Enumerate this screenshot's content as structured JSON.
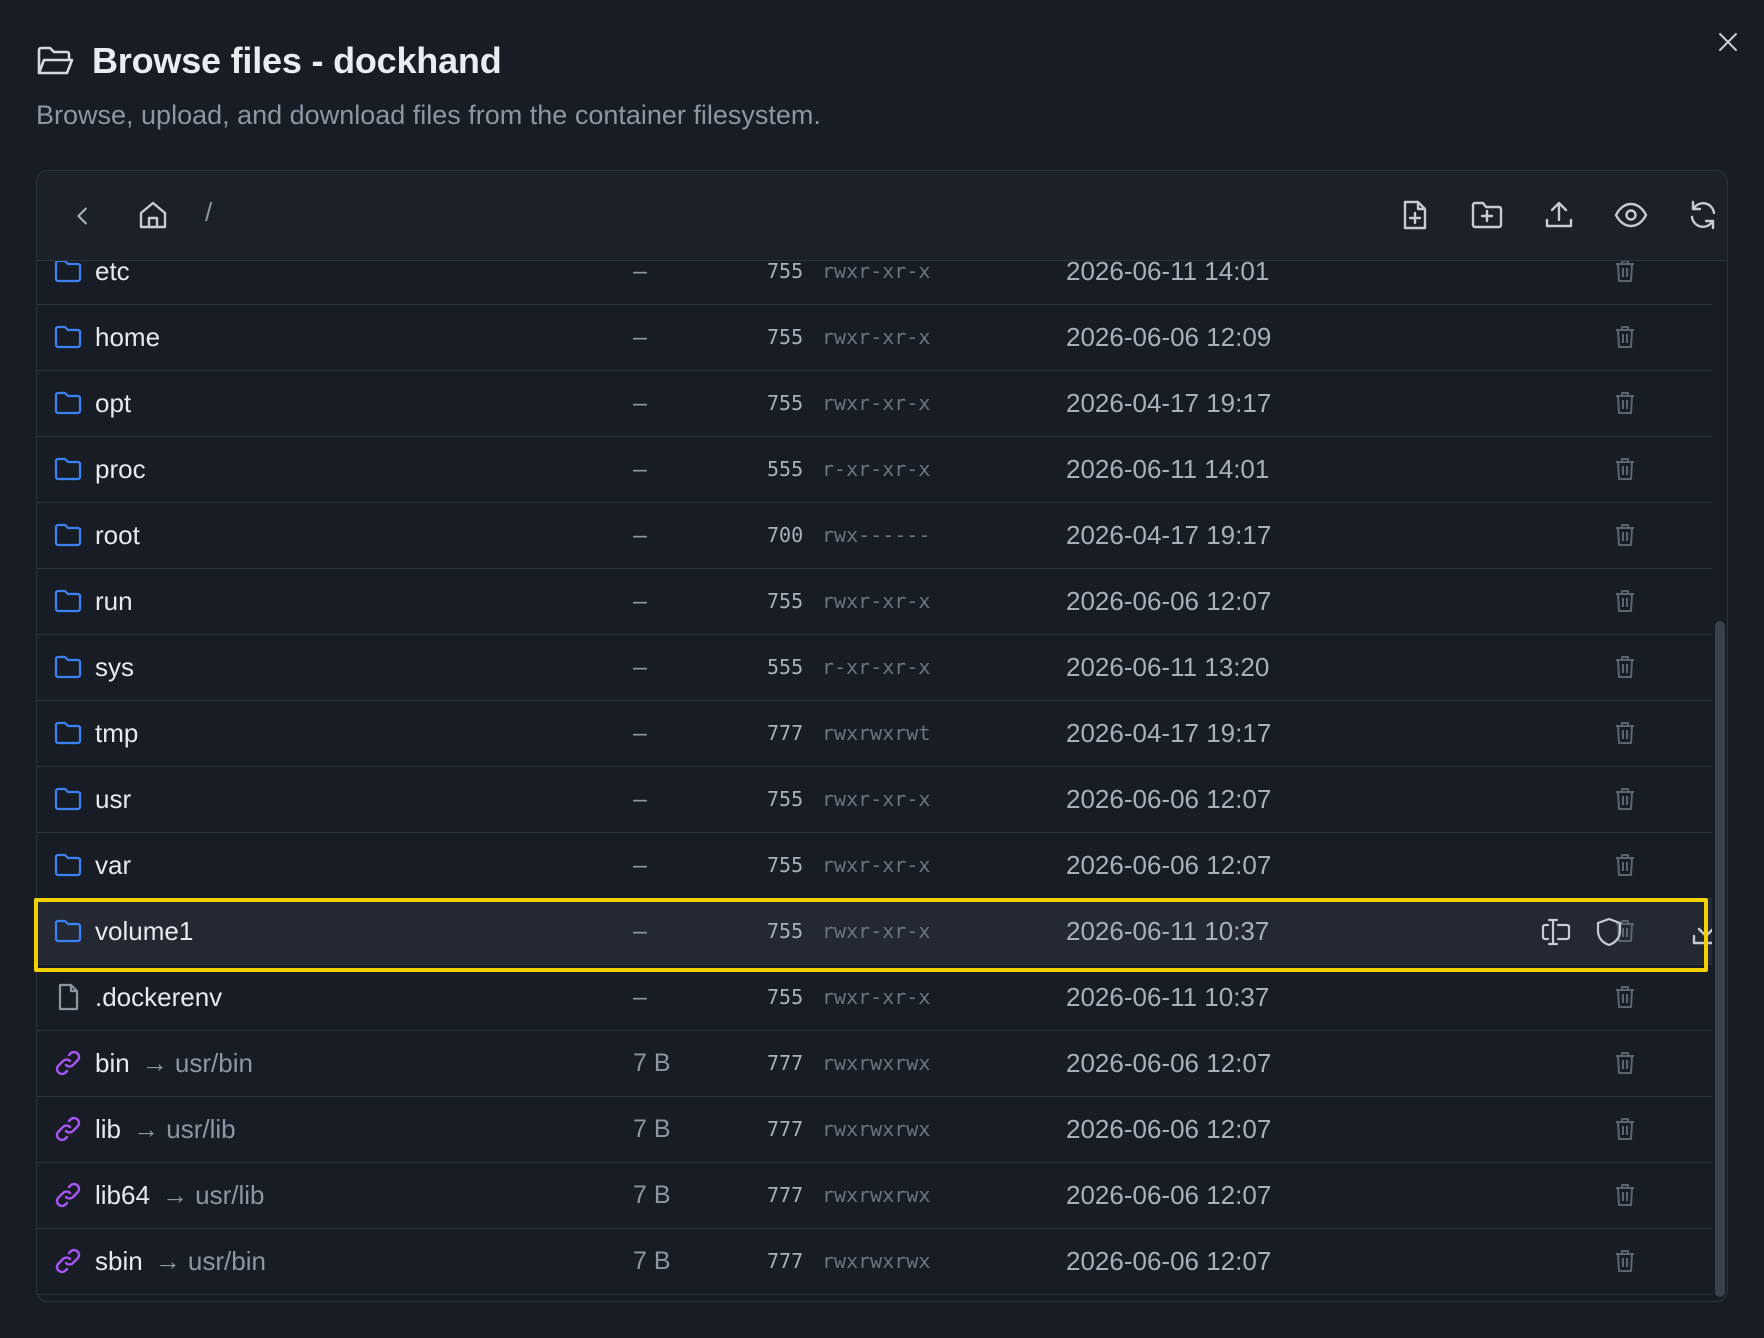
{
  "dialog": {
    "title": "Browse files - dockhand",
    "subtitle": "Browse, upload, and download files from the container filesystem."
  },
  "toolbar": {
    "path": "/"
  },
  "icons": {
    "folder": "folder-icon",
    "file": "file-icon",
    "symlink": "link-icon",
    "delete": "trash-icon"
  },
  "colors": {
    "folder": "#3b82f6",
    "symlink": "#a855f7",
    "highlight": "#f2d100"
  },
  "files": [
    {
      "name": "etc",
      "type": "folder",
      "size": "–",
      "octal": "755",
      "perm": "rwxr-xr-x",
      "date": "2026-06-11 14:01"
    },
    {
      "name": "home",
      "type": "folder",
      "size": "–",
      "octal": "755",
      "perm": "rwxr-xr-x",
      "date": "2026-06-06 12:09"
    },
    {
      "name": "opt",
      "type": "folder",
      "size": "–",
      "octal": "755",
      "perm": "rwxr-xr-x",
      "date": "2026-04-17 19:17"
    },
    {
      "name": "proc",
      "type": "folder",
      "size": "–",
      "octal": "555",
      "perm": "r-xr-xr-x",
      "date": "2026-06-11 14:01"
    },
    {
      "name": "root",
      "type": "folder",
      "size": "–",
      "octal": "700",
      "perm": "rwx------",
      "date": "2026-04-17 19:17"
    },
    {
      "name": "run",
      "type": "folder",
      "size": "–",
      "octal": "755",
      "perm": "rwxr-xr-x",
      "date": "2026-06-06 12:07"
    },
    {
      "name": "sys",
      "type": "folder",
      "size": "–",
      "octal": "555",
      "perm": "r-xr-xr-x",
      "date": "2026-06-11 13:20"
    },
    {
      "name": "tmp",
      "type": "folder",
      "size": "–",
      "octal": "777",
      "perm": "rwxrwxrwt",
      "date": "2026-04-17 19:17"
    },
    {
      "name": "usr",
      "type": "folder",
      "size": "–",
      "octal": "755",
      "perm": "rwxr-xr-x",
      "date": "2026-06-06 12:07"
    },
    {
      "name": "var",
      "type": "folder",
      "size": "–",
      "octal": "755",
      "perm": "rwxr-xr-x",
      "date": "2026-06-06 12:07"
    },
    {
      "name": "volume1",
      "type": "folder",
      "size": "–",
      "octal": "755",
      "perm": "rwxr-xr-x",
      "date": "2026-06-11 10:37",
      "hover": true
    },
    {
      "name": ".dockerenv",
      "type": "file",
      "size": "–",
      "octal": "755",
      "perm": "rwxr-xr-x",
      "date": "2026-06-11 10:37"
    },
    {
      "name": "bin",
      "type": "symlink",
      "target": "→ usr/bin",
      "size": "7 B",
      "octal": "777",
      "perm": "rwxrwxrwx",
      "date": "2026-06-06 12:07"
    },
    {
      "name": "lib",
      "type": "symlink",
      "target": "→ usr/lib",
      "size": "7 B",
      "octal": "777",
      "perm": "rwxrwxrwx",
      "date": "2026-06-06 12:07"
    },
    {
      "name": "lib64",
      "type": "symlink",
      "target": "→ usr/lib",
      "size": "7 B",
      "octal": "777",
      "perm": "rwxrwxrwx",
      "date": "2026-06-06 12:07"
    },
    {
      "name": "sbin",
      "type": "symlink",
      "target": "→ usr/bin",
      "size": "7 B",
      "octal": "777",
      "perm": "rwxrwxrwx",
      "date": "2026-06-06 12:07"
    }
  ]
}
